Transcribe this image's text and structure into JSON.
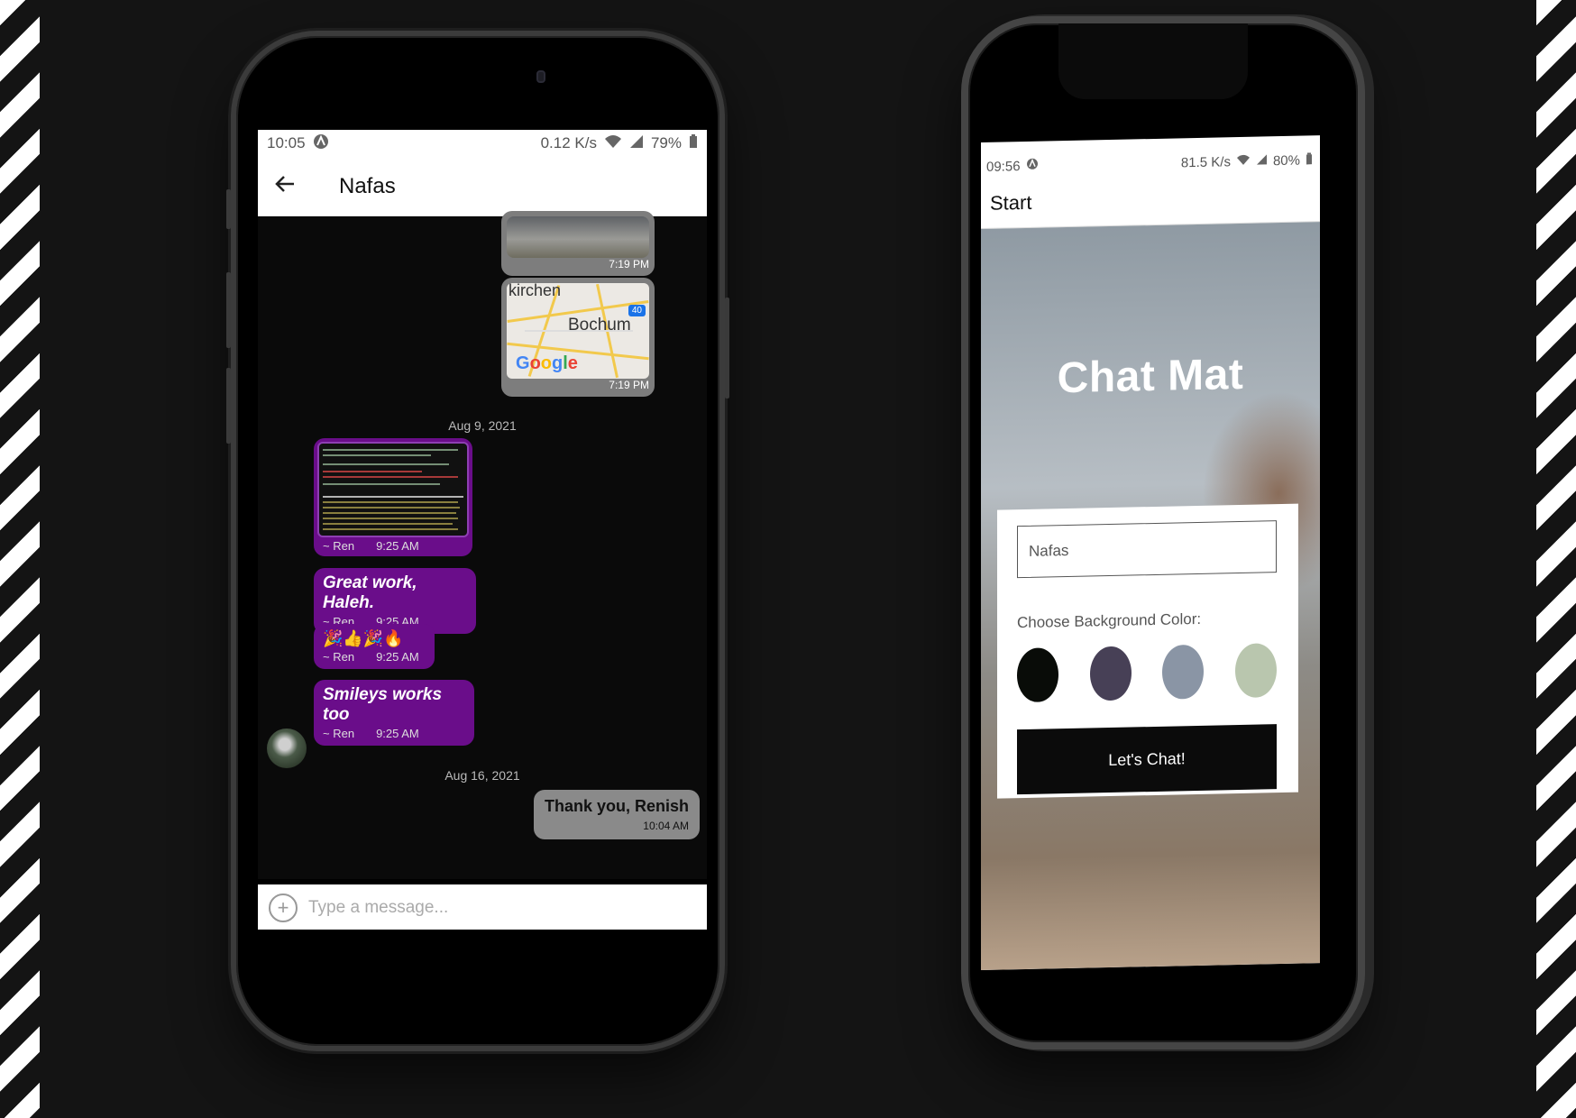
{
  "chat_screen": {
    "status": {
      "time": "10:05",
      "speed": "0.12 K/s",
      "battery": "79%"
    },
    "header": {
      "title": "Nafas",
      "back_icon": "arrow-left-icon"
    },
    "messages": {
      "image_time": "7:19 PM",
      "map": {
        "time": "7:19 PM",
        "city": "Bochum",
        "top_label": "kirchen",
        "brand": "Google",
        "shield": "40"
      },
      "date_1": "Aug 9, 2021",
      "screenshot": {
        "sender": "~ Ren",
        "time": "9:25 AM"
      },
      "msg_1": {
        "text": "Great work, Haleh.",
        "sender": "~ Ren",
        "time": "9:25 AM"
      },
      "msg_2": {
        "text": "🎉👍🎉🔥",
        "sender": "~ Ren",
        "time": "9:25 AM"
      },
      "msg_3": {
        "text": "Smileys works too",
        "sender": "~ Ren",
        "time": "9:25 AM"
      },
      "date_2": "Aug 16, 2021",
      "msg_4": {
        "text": "Thank you, Renish",
        "time": "10:04 AM"
      }
    },
    "input": {
      "placeholder": "Type a message..."
    }
  },
  "start_screen": {
    "status": {
      "time": "09:56",
      "speed": "81.5 K/s",
      "battery": "80%"
    },
    "header": {
      "title": "Start"
    },
    "app_title": "Chat Mat",
    "name_value": "Nafas",
    "bg_label": "Choose Background Color:",
    "swatch_colors": [
      "#090C08",
      "#474056",
      "#8A95A5",
      "#B9C6AE"
    ],
    "button_label": "Let's Chat!"
  }
}
